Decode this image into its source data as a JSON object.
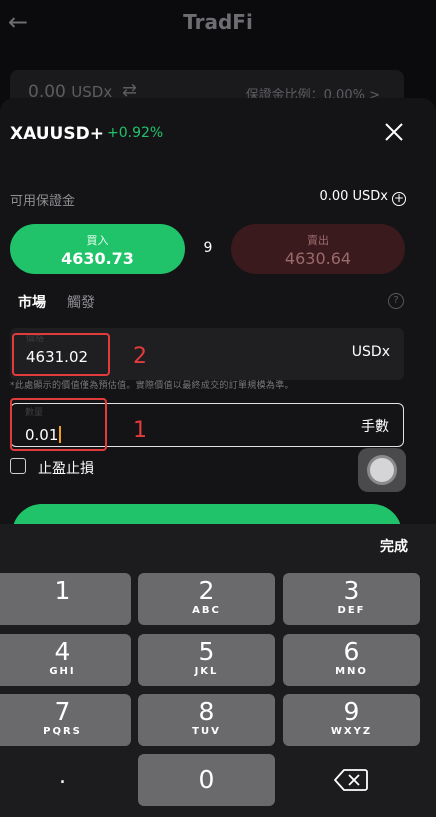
{
  "background": {
    "title": "TradFi",
    "balance_value": "0.00",
    "balance_unit": "USDx",
    "margin_ratio_label": "保證金比例：0.00%",
    "margin_ratio_chevron": ">"
  },
  "order_sheet": {
    "symbol": "XAUUSD+",
    "change": "+0.92%",
    "available_label": "可用保證金",
    "available_value": "0.00 USDx",
    "buy": {
      "label": "買入",
      "price": "4630.73"
    },
    "spread": "9",
    "sell": {
      "label": "賣出",
      "price": "4630.64"
    },
    "tabs": [
      {
        "label": "市場"
      },
      {
        "label": "觸發"
      }
    ],
    "help_glyph": "?",
    "price_field": {
      "label": "價格",
      "value": "4631.02",
      "unit": "USDx"
    },
    "price_note": "*此處顯示的價值僅為預估值。實際價值以最終成交的訂單規模為準。",
    "quantity_field": {
      "label": "數量",
      "value": "0.01",
      "unit": "手數"
    },
    "take_profit_stop_loss": "止盈止損"
  },
  "annotations": [
    {
      "number": "1"
    },
    {
      "number": "2"
    }
  ],
  "keyboard": {
    "done_label": "完成",
    "keys": [
      {
        "digit": "1",
        "letters": ""
      },
      {
        "digit": "2",
        "letters": "ABC"
      },
      {
        "digit": "3",
        "letters": "DEF"
      },
      {
        "digit": "4",
        "letters": "GHI"
      },
      {
        "digit": "5",
        "letters": "JKL"
      },
      {
        "digit": "6",
        "letters": "MNO"
      },
      {
        "digit": "7",
        "letters": "PQRS"
      },
      {
        "digit": "8",
        "letters": "TUV"
      },
      {
        "digit": "9",
        "letters": "WXYZ"
      },
      {
        "digit": "0",
        "letters": ""
      }
    ],
    "decimal": "."
  },
  "colors": {
    "buy_green": "#20c36a",
    "sell_red": "#3a1a1c",
    "change_green": "#21c26b",
    "annotation_red": "#e23b3b",
    "caret_orange": "#f0a020"
  },
  "icons": {
    "back": "back-arrow-icon",
    "swap": "swap-icon",
    "close": "close-icon",
    "add": "plus-circle-icon",
    "help": "help-icon",
    "backspace": "backspace-icon"
  }
}
